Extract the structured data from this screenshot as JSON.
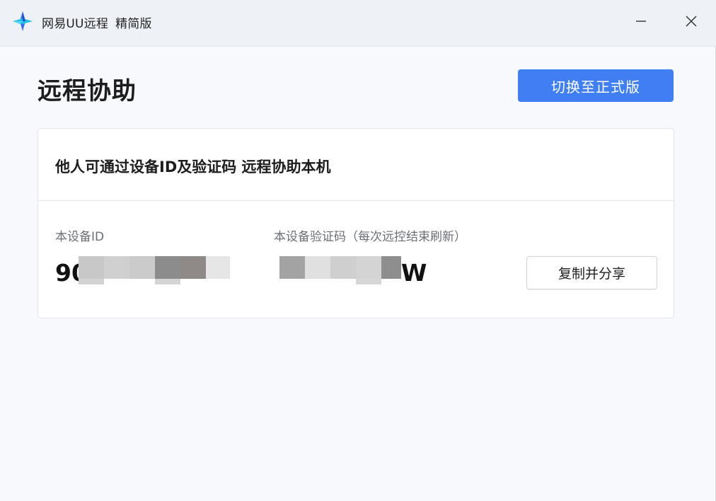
{
  "titlebar": {
    "app_name": "网易UU远程",
    "edition": "精简版",
    "logo_icon": "uu-remote-logo-icon",
    "minimize_icon": "minimize-icon",
    "close_icon": "close-icon"
  },
  "header": {
    "title": "远程协助",
    "switch_button": "切换至正式版"
  },
  "card": {
    "heading": "他人可通过设备ID及验证码 远程协助本机",
    "device_id": {
      "label": "本设备ID",
      "visible_prefix": "90",
      "masked": true
    },
    "verify_code": {
      "label": "本设备验证码（每次远控结束刷新）",
      "visible_suffix": "W",
      "masked": true
    },
    "copy_button": "复制并分享"
  },
  "colors": {
    "accent": "#3f7ff3",
    "background": "#f7f9fc",
    "titlebar": "#eef1f5",
    "card": "#ffffff"
  }
}
